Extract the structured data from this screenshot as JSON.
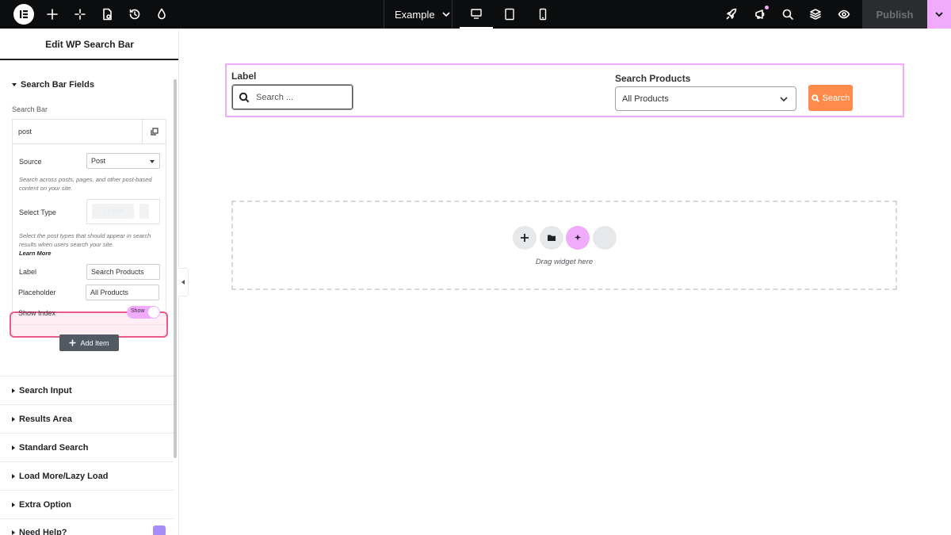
{
  "topbar": {
    "page_name": "Example",
    "publish_label": "Publish"
  },
  "sidebar": {
    "title": "Edit WP Search Bar",
    "section_open": "Search Bar Fields",
    "search_bar_label": "Search Bar",
    "repeater_item": "post",
    "source_label": "Source",
    "source_value": "Post",
    "source_help": "Search across posts, pages, and other post-based content on your site.",
    "select_type_label": "Select Type",
    "select_type_chip": "+ Pages",
    "select_type_help": "Select the post types that should appear in search results when users search your site.",
    "learn_more": "Learn More",
    "label_label": "Label",
    "label_value": "Search Products",
    "placeholder_label": "Placeholder",
    "placeholder_value": "All Products",
    "show_index_label": "Show Index",
    "show_index_toggle": "Show",
    "add_item": "Add Item",
    "sections": [
      "Search Input",
      "Results Area",
      "Standard Search",
      "Load More/Lazy Load",
      "Extra Option",
      "Need Help?"
    ]
  },
  "canvas": {
    "widget_label": "Label",
    "search_placeholder": "Search ...",
    "dropdown_label": "Search Products",
    "dropdown_value": "All Products",
    "search_button": "Search",
    "drag_text": "Drag widget here"
  },
  "colors": {
    "accent": "#f0abfc",
    "search_button": "#ff8a4c",
    "highlight": "#ea5b8a",
    "topbar": "#0c0d0e"
  }
}
